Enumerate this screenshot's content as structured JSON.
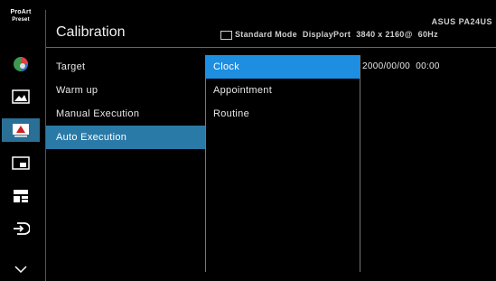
{
  "brand": {
    "line1": "ProArt",
    "line2": "Preset"
  },
  "header": {
    "title": "Calibration",
    "model": "ASUS PA24US",
    "mode": "Standard Mode",
    "input": "DisplayPort",
    "resolution": "3840 x 2160@",
    "refresh": "60Hz"
  },
  "sidebar": {
    "icons": [
      "proart-preset-icon",
      "color-palette-icon",
      "image-icon",
      "calibration-icon",
      "pip-icon",
      "qr-icon",
      "input-select-icon",
      "chevron-down-icon"
    ],
    "active_index": 3
  },
  "menu": {
    "items": [
      "Target",
      "Warm up",
      "Manual Execution",
      "Auto Execution"
    ],
    "selected_index": 3
  },
  "submenu": {
    "items": [
      "Clock",
      "Appointment",
      "Routine"
    ],
    "selected_index": 0
  },
  "value": {
    "date": "2000/00/00",
    "time": "00:00"
  },
  "colors": {
    "menu_selected": "#2a7aa8",
    "submenu_selected": "#1d8ee0",
    "sidebar_active": "#2a6f96"
  }
}
